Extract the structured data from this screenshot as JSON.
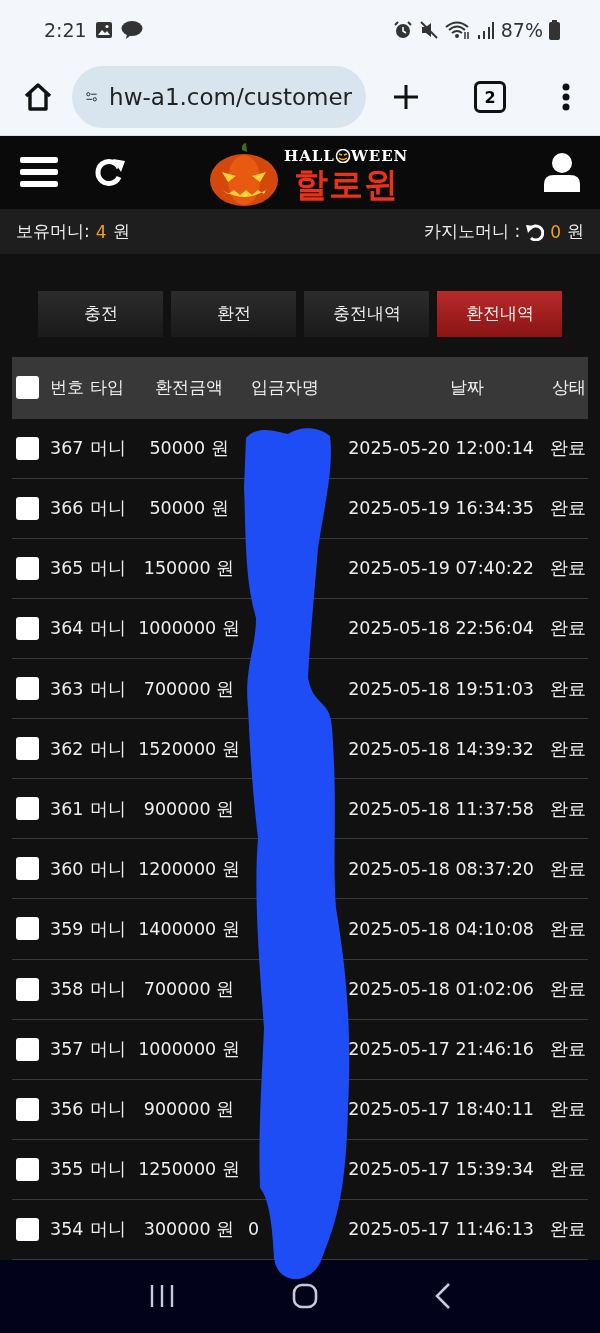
{
  "status_bar": {
    "time": "2:21",
    "battery": "87%"
  },
  "browser": {
    "url": "hw-a1.com/customer",
    "tab_count": "2"
  },
  "header": {
    "logo": {
      "word_left": "HALL",
      "word_right": "WEEN",
      "title": "할로윈"
    }
  },
  "balance": {
    "label": "보유머니:",
    "amount": "4",
    "unit": "원",
    "casino_label": "카지노머니 :",
    "casino_amount": "0",
    "casino_unit": "원"
  },
  "tabs": [
    {
      "label": "충전",
      "selected": false
    },
    {
      "label": "환전",
      "selected": false
    },
    {
      "label": "충전내역",
      "selected": false
    },
    {
      "label": "환전내역",
      "selected": true
    }
  ],
  "table": {
    "select_all": {
      "checked": false
    },
    "columns": [
      "번호",
      "타입",
      "환전금액",
      "입금자명",
      "날짜",
      "상태"
    ],
    "rows": [
      {
        "checked": false,
        "number": "367",
        "type": "머니",
        "amount": "50000 원",
        "date": "2025-05-20 12:00:14",
        "status": "완료"
      },
      {
        "checked": false,
        "number": "366",
        "type": "머니",
        "amount": "50000 원",
        "date": "2025-05-19 16:34:35",
        "status": "완료"
      },
      {
        "checked": false,
        "number": "365",
        "type": "머니",
        "amount": "150000 원",
        "date": "2025-05-19 07:40:22",
        "status": "완료"
      },
      {
        "checked": false,
        "number": "364",
        "type": "머니",
        "amount": "1000000 원",
        "date": "2025-05-18 22:56:04",
        "status": "완료"
      },
      {
        "checked": false,
        "number": "363",
        "type": "머니",
        "amount": "700000 원",
        "date": "2025-05-18 19:51:03",
        "status": "완료"
      },
      {
        "checked": false,
        "number": "362",
        "type": "머니",
        "amount": "1520000 원",
        "date": "2025-05-18 14:39:32",
        "status": "완료"
      },
      {
        "checked": false,
        "number": "361",
        "type": "머니",
        "amount": "900000 원",
        "date": "2025-05-18 11:37:58",
        "status": "완료"
      },
      {
        "checked": false,
        "number": "360",
        "type": "머니",
        "amount": "1200000 원",
        "date": "2025-05-18 08:37:20",
        "status": "완료"
      },
      {
        "checked": false,
        "number": "359",
        "type": "머니",
        "amount": "1400000 원",
        "date": "2025-05-18 04:10:08",
        "status": "완료"
      },
      {
        "checked": false,
        "number": "358",
        "type": "머니",
        "amount": "700000 원",
        "date": "2025-05-18 01:02:06",
        "status": "완료"
      },
      {
        "checked": false,
        "number": "357",
        "type": "머니",
        "amount": "1000000 원",
        "date": "2025-05-17 21:46:16",
        "status": "완료"
      },
      {
        "checked": false,
        "number": "356",
        "type": "머니",
        "amount": "900000 원",
        "date": "2025-05-17 18:40:11",
        "status": "완료"
      },
      {
        "checked": false,
        "number": "355",
        "type": "머니",
        "amount": "1250000 원",
        "date": "2025-05-17 15:39:34",
        "status": "완료"
      },
      {
        "checked": false,
        "number": "354",
        "type": "머니",
        "amount": "300000 원",
        "depositor": "0",
        "date": "2025-05-17 11:46:13",
        "status": "완료"
      }
    ]
  }
}
